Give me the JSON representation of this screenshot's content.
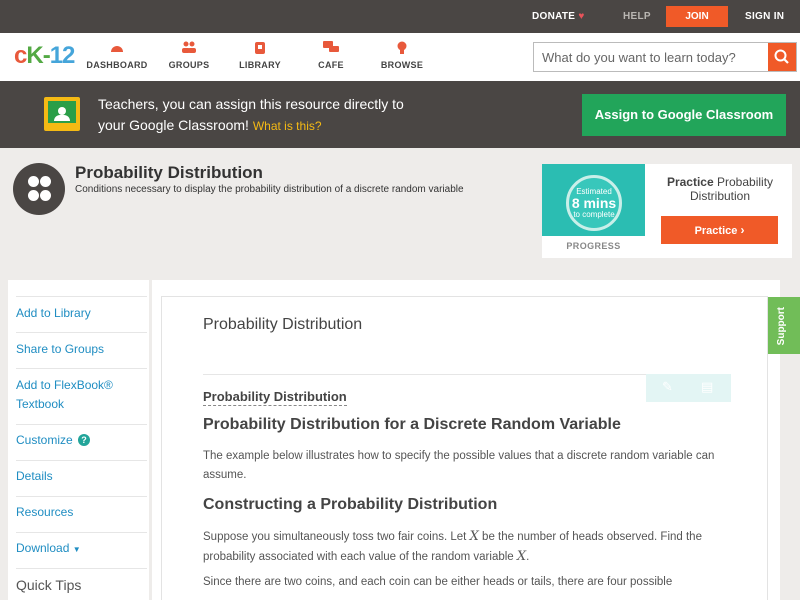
{
  "topbar": {
    "donate": "DONATE",
    "help": "HELP",
    "join": "JOIN",
    "signin": "SIGN IN"
  },
  "nav": {
    "logo": {
      "c": "c",
      "k": "K",
      "dash": "-",
      "num": "12"
    },
    "items": [
      {
        "label": "DASHBOARD"
      },
      {
        "label": "GROUPS"
      },
      {
        "label": "LIBRARY"
      },
      {
        "label": "CAFE"
      },
      {
        "label": "BROWSE"
      }
    ],
    "search_placeholder": "What do you want to learn today?"
  },
  "google_banner": {
    "line1": "Teachers, you can assign this resource directly to",
    "line2": "your Google Classroom!",
    "what": "What is this?",
    "button": "Assign to Google Classroom"
  },
  "header": {
    "title": "Probability Distribution",
    "subtitle": "Conditions necessary to display the probability distribution of a discrete random variable"
  },
  "practice": {
    "estimated": "Estimated",
    "mins": "8 mins",
    "to_complete": "to complete",
    "progress": "PROGRESS",
    "title_bold": "Practice",
    "title_rest": "Probability Distribution",
    "button": "Practice"
  },
  "sidebar": {
    "items": [
      {
        "label": "Add to Library"
      },
      {
        "label": "Share to Groups"
      },
      {
        "label": "Add to FlexBook® Textbook"
      },
      {
        "label": "Customize"
      },
      {
        "label": "Details"
      },
      {
        "label": "Resources"
      },
      {
        "label": "Download"
      }
    ],
    "quick_tips": "Quick Tips"
  },
  "content": {
    "title": "Probability Distribution",
    "subhead": "Probability Distribution",
    "h2a": "Probability Distribution for a Discrete Random Variable",
    "p1": "The example below illustrates how to specify the possible values that a discrete random variable can assume.",
    "h2b": "Constructing a Probability Distribution",
    "p2a": "Suppose you simultaneously toss two fair coins. Let",
    "p2b": "be the number of heads observed. Find the probability associated with each value of the random variable",
    "var": "X",
    "p3": "Since there are two coins, and each coin can be either heads or tails, there are four possible"
  },
  "support": "Support",
  "colors": {
    "accent": "#f05a28",
    "dark": "#4a4644",
    "green": "#22a55a",
    "link": "#1f8dc2"
  }
}
